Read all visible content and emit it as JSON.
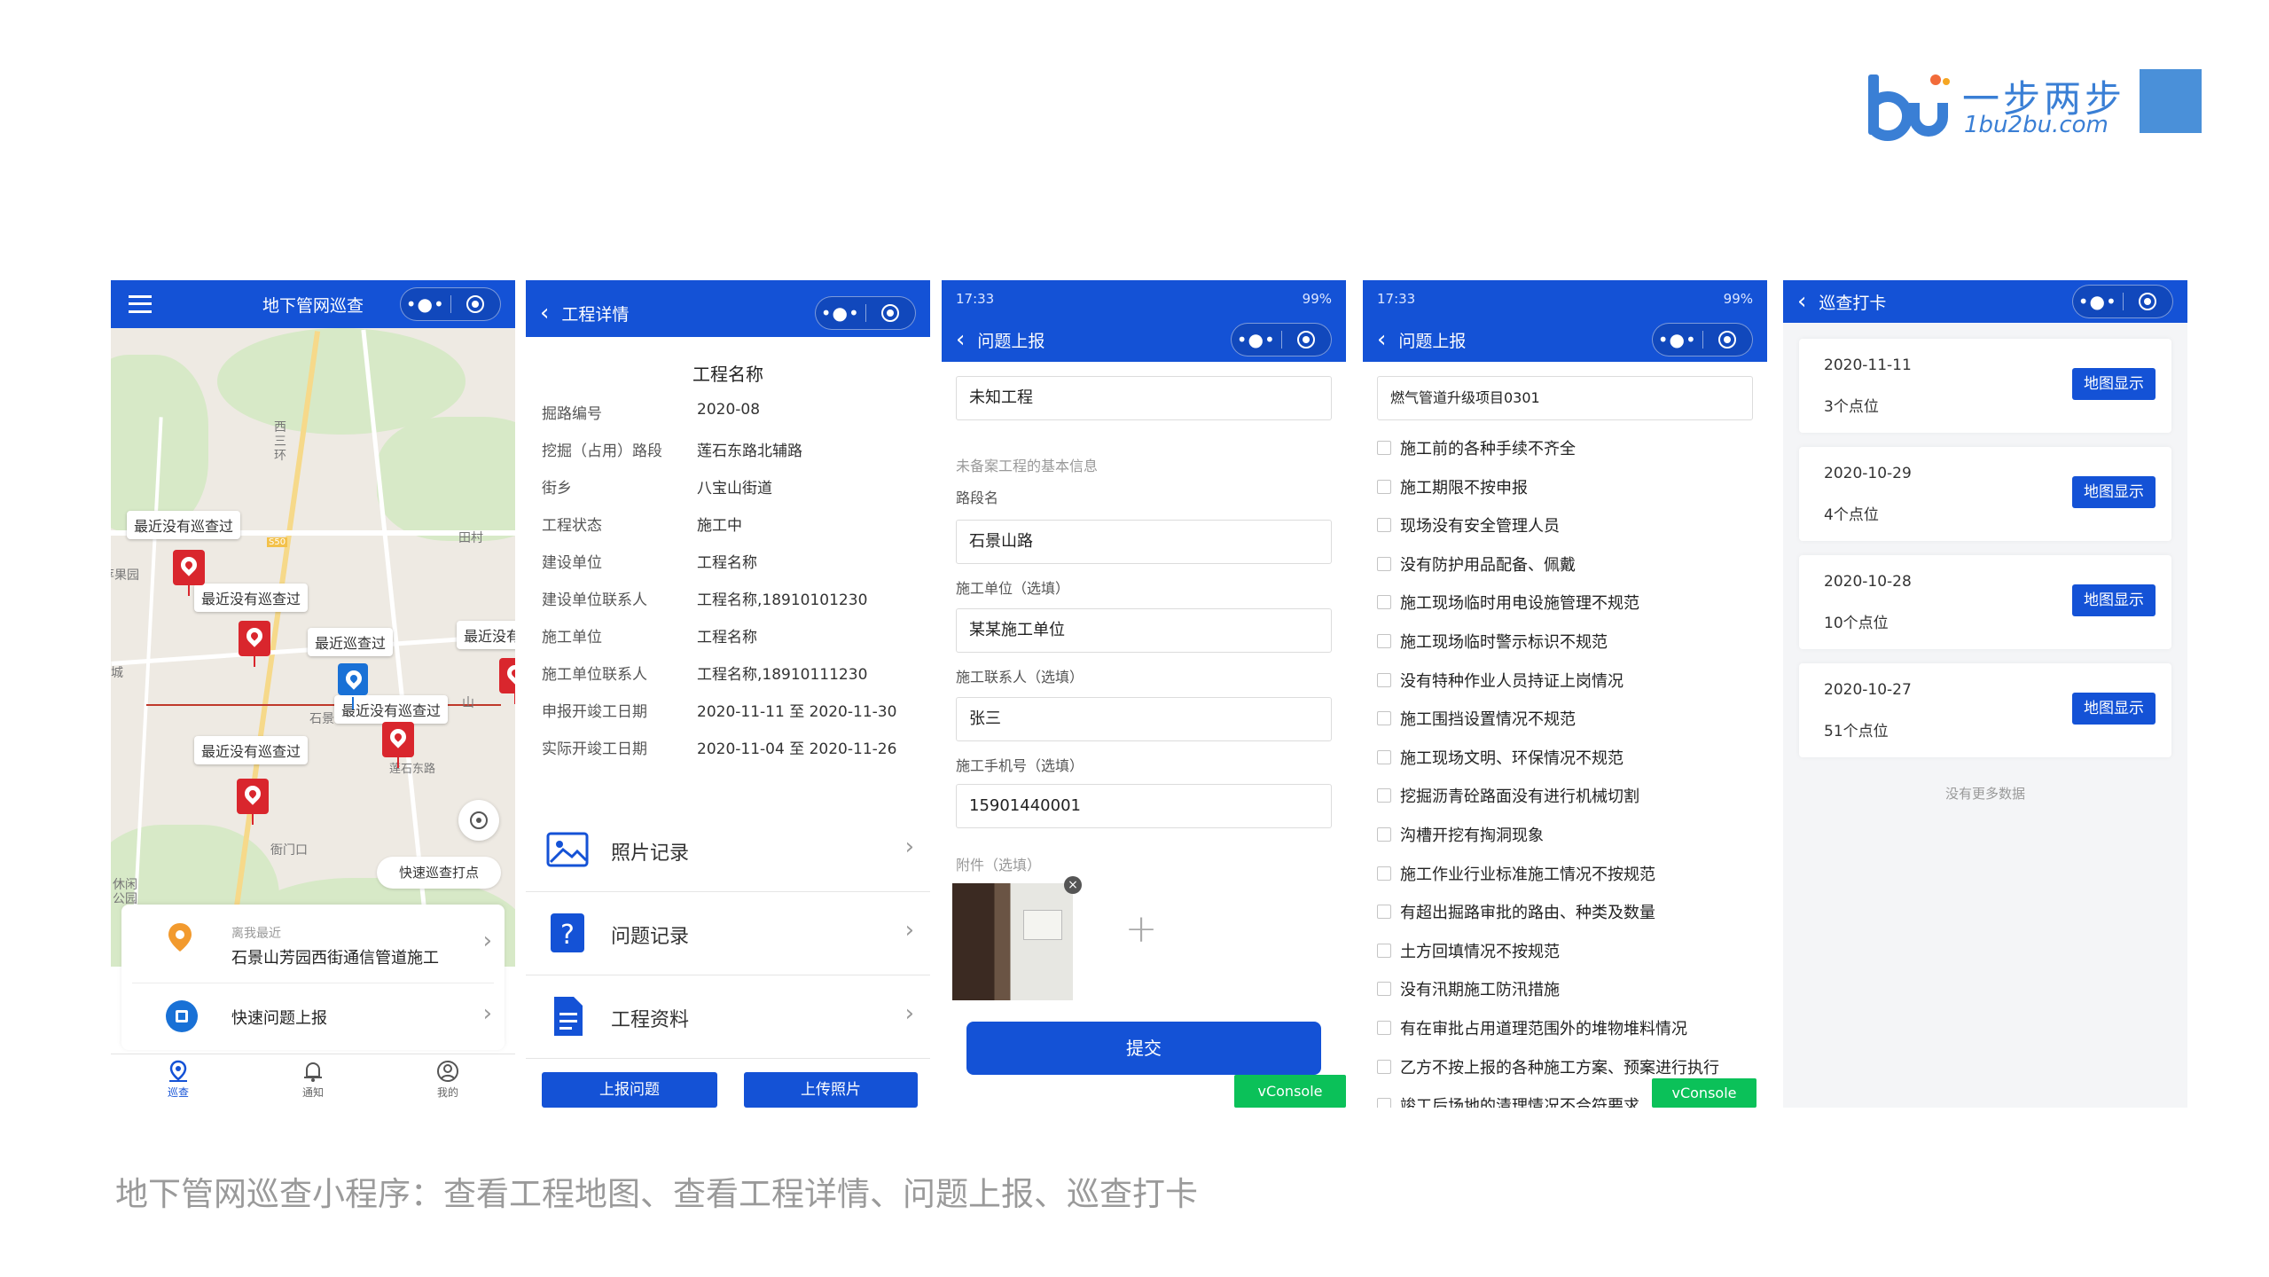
{
  "brand": {
    "name": "一步两步",
    "domain": "1bu2bu.com",
    "accent": "#4a90d9"
  },
  "caption": "地下管网巡查小程序：查看工程地图、查看工程详情、问题上报、巡查打卡",
  "colors": {
    "primary": "#1452d6",
    "pin_red": "#d9262d",
    "pin_blue": "#1971d6",
    "vconsole": "#0bc159"
  },
  "screen1": {
    "title": "地下管网巡查",
    "menu_icon": "hamburger-icon",
    "map_labels": [
      "西三环",
      "田村",
      "苹果园",
      "石景",
      "莲石东路",
      "衙门口",
      "休闲公园",
      "城",
      "山",
      "S50"
    ],
    "callouts": [
      "最近没有巡查过",
      "最近没有巡查过",
      "最近巡查过",
      "最近没有巡查过",
      "最近没有巡查过",
      "最近没有"
    ],
    "quick_checkin": "快速巡查打点",
    "nearest_label": "离我最近",
    "nearest_project": "石景山芳园西街通信管道施工",
    "quick_report": "快速问题上报",
    "tabs": [
      "巡查",
      "通知",
      "我的"
    ]
  },
  "screen2": {
    "title": "工程详情",
    "project_name": "工程名称",
    "rows": [
      {
        "k": "掘路编号",
        "v": "2020-08"
      },
      {
        "k": "挖掘（占用）路段",
        "v": "莲石东路北辅路"
      },
      {
        "k": "街乡",
        "v": "八宝山街道"
      },
      {
        "k": "工程状态",
        "v": "施工中"
      },
      {
        "k": "建设单位",
        "v": "工程名称"
      },
      {
        "k": "建设单位联系人",
        "v": "工程名称,18910101230"
      },
      {
        "k": "施工单位",
        "v": "工程名称"
      },
      {
        "k": "施工单位联系人",
        "v": "工程名称,18910111230"
      },
      {
        "k": "申报开竣工日期",
        "v": "2020-11-11 至 2020-11-30"
      },
      {
        "k": "实际开竣工日期",
        "v": "2020-11-04 至 2020-11-26"
      }
    ],
    "menu": [
      "照片记录",
      "问题记录",
      "工程资料"
    ],
    "btn_report": "上报问题",
    "btn_upload": "上传照片"
  },
  "screen3": {
    "status_time": "17:33",
    "status_battery": "99%",
    "title": "问题上报",
    "project": "未知工程",
    "section_title": "未备案工程的基本信息",
    "road_label": "路段名",
    "road_value": "石景山路",
    "unit_label": "施工单位（选填）",
    "unit_value": "某某施工单位",
    "contact_label": "施工联系人（选填）",
    "contact_value": "张三",
    "phone_label": "施工手机号（选填）",
    "phone_value": "15901440001",
    "attach_label": "附件（选填）",
    "submit": "提交",
    "vconsole": "vConsole"
  },
  "screen4": {
    "status_time": "17:33",
    "status_battery": "99%",
    "title": "问题上报",
    "project": "燃气管道升级项目0301",
    "items": [
      "施工前的各种手续不齐全",
      "施工期限不按申报",
      "现场没有安全管理人员",
      "没有防护用品配备、佩戴",
      "施工现场临时用电设施管理不规范",
      "施工现场临时警示标识不规范",
      "没有特种作业人员持证上岗情况",
      "施工围挡设置情况不规范",
      "施工现场文明、环保情况不规范",
      "挖掘沥青砼路面没有进行机械切割",
      "沟槽开挖有掏洞现象",
      "施工作业行业标准施工情况不按规范",
      "有超出掘路审批的路由、种类及数量",
      "土方回填情况不按规范",
      "没有汛期施工防汛措施",
      "有在审批占用道理范围外的堆物堆料情况",
      "乙方不按上报的各种施工方案、预案进行执行",
      "竣工后场地的清理情况不合符要求"
    ],
    "vconsole": "vConsole"
  },
  "screen5": {
    "title": "巡查打卡",
    "records": [
      {
        "date": "2020-11-11",
        "count": "3个点位",
        "btn": "地图显示"
      },
      {
        "date": "2020-10-29",
        "count": "4个点位",
        "btn": "地图显示"
      },
      {
        "date": "2020-10-28",
        "count": "10个点位",
        "btn": "地图显示"
      },
      {
        "date": "2020-10-27",
        "count": "51个点位",
        "btn": "地图显示"
      }
    ],
    "no_more": "没有更多数据"
  }
}
